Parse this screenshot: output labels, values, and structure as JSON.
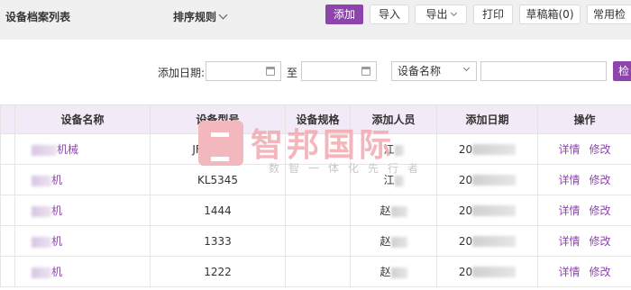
{
  "header": {
    "title": "设备档案列表",
    "sort_label": "排序规则",
    "buttons": {
      "add": "添加",
      "import": "导入",
      "export": "导出",
      "print": "打印",
      "drafts": "草稿箱(0)",
      "common_search": "常用检"
    }
  },
  "filter": {
    "date_label": "添加日期:",
    "date_start": "",
    "to_label": "至",
    "date_end": "",
    "field_select": "设备名称",
    "keyword": "",
    "search_button": "检"
  },
  "table": {
    "columns": [
      "设备名称",
      "设备型号",
      "设备规格",
      "添加人员",
      "添加日期",
      "操作"
    ],
    "rows": [
      {
        "name": "机械",
        "model": "JF685845",
        "spec": "",
        "user": "江",
        "date": "20"
      },
      {
        "name": "机",
        "model": "KL5345",
        "spec": "",
        "user": "江",
        "date": "20"
      },
      {
        "name": "机",
        "model": "1444",
        "spec": "",
        "user": "赵",
        "date": "20"
      },
      {
        "name": "机",
        "model": "1333",
        "spec": "",
        "user": "赵",
        "date": "20"
      },
      {
        "name": "机",
        "model": "1222",
        "spec": "",
        "user": "赵",
        "date": "20"
      }
    ],
    "actions": {
      "detail": "详情",
      "edit": "修改"
    }
  },
  "watermark": {
    "title": "智邦国际",
    "subtitle": "数智一体化先行者"
  },
  "colors": {
    "accent": "#8e44ad",
    "header_bg": "#f3eaf7",
    "topbar_bg": "#f0f0f0"
  }
}
